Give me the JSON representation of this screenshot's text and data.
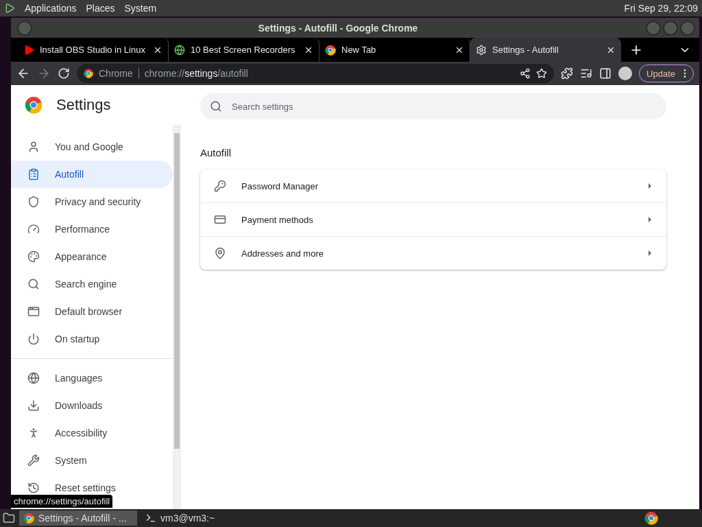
{
  "top_panel": {
    "menus": [
      "Applications",
      "Places",
      "System"
    ],
    "clock": "Fri Sep 29, 22:09"
  },
  "window": {
    "title": "Settings - Autofill - Google Chrome"
  },
  "tabs": [
    {
      "title": "Install OBS Studio in Linux",
      "kind": "video",
      "selected": false
    },
    {
      "title": "10 Best Screen Recorders",
      "kind": "site",
      "selected": false
    },
    {
      "title": "New Tab",
      "kind": "chrome",
      "selected": false
    },
    {
      "title": "Settings - Autofill",
      "kind": "settings",
      "selected": true
    }
  ],
  "toolbar": {
    "site_label": "Chrome",
    "url": {
      "scheme": "chrome://",
      "host": "settings",
      "path": "/autofill"
    },
    "update_button": "Update"
  },
  "settings": {
    "title": "Settings",
    "search": {
      "placeholder": "Search settings"
    }
  },
  "sidebar": {
    "sections": [
      {
        "items": [
          {
            "label": "You and Google",
            "selected": false
          },
          {
            "label": "Autofill",
            "selected": true
          },
          {
            "label": "Privacy and security",
            "selected": false
          },
          {
            "label": "Performance",
            "selected": false
          },
          {
            "label": "Appearance",
            "selected": false
          },
          {
            "label": "Search engine",
            "selected": false
          },
          {
            "label": "Default browser",
            "selected": false
          },
          {
            "label": "On startup",
            "selected": false
          }
        ]
      },
      {
        "items": [
          {
            "label": "Languages",
            "selected": false
          },
          {
            "label": "Downloads",
            "selected": false
          },
          {
            "label": "Accessibility",
            "selected": false
          },
          {
            "label": "System",
            "selected": false
          },
          {
            "label": "Reset settings",
            "selected": false
          }
        ]
      }
    ]
  },
  "section": {
    "title": "Autofill",
    "rows": [
      {
        "label": "Password Manager"
      },
      {
        "label": "Payment methods"
      },
      {
        "label": "Addresses and more"
      }
    ]
  },
  "status_bubble": "chrome://settings/autofill",
  "taskbar": {
    "tasks": [
      {
        "label": "Settings - Autofill - ...",
        "kind": "browser",
        "selected": true
      },
      {
        "label": "vm3@vm3:~",
        "kind": "terminal",
        "selected": false
      }
    ]
  }
}
